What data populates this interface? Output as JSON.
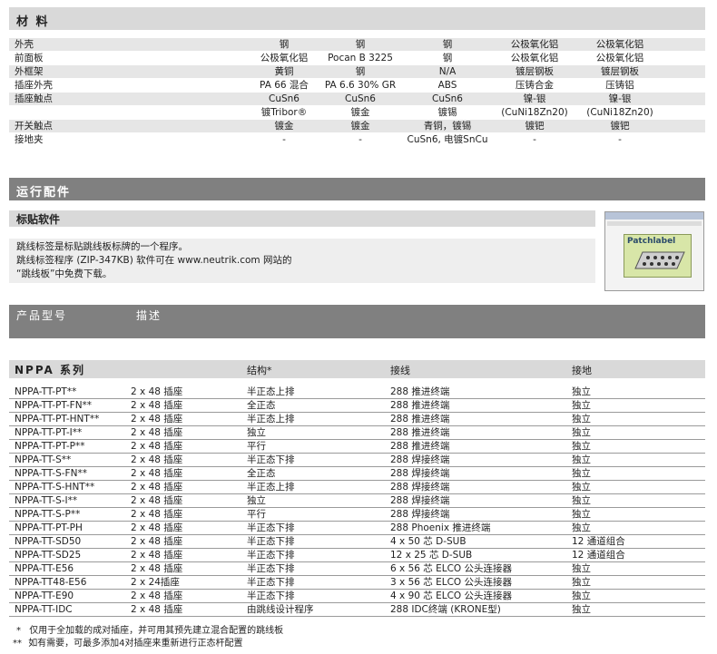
{
  "materials": {
    "title": "材 料",
    "rows": [
      {
        "label": "外壳",
        "values": [
          "钢",
          "钢",
          "钢",
          "公极氧化铝",
          "公极氧化铝"
        ]
      },
      {
        "label": "前面板",
        "values": [
          "公极氧化铝",
          "Pocan B 3225",
          "钢",
          "公极氧化铝",
          "公极氧化铝"
        ]
      },
      {
        "label": "外框架",
        "values": [
          "黄铜",
          "钢",
          "N/A",
          "镀层钢板",
          "镀层钢板"
        ]
      },
      {
        "label": "插座外壳",
        "values": [
          "PA 66 混合",
          "PA 6.6 30% GR",
          "ABS",
          "压铸合金",
          "压铸铝"
        ]
      },
      {
        "label": "插座触点",
        "values": [
          "CuSn6",
          "CuSn6",
          "CuSn6",
          "镍-银",
          "镍-银"
        ]
      },
      {
        "label": "",
        "values": [
          "镀Tribor®",
          "镀金",
          "镀锡",
          "(CuNi18Zn20)",
          "(CuNi18Zn20)"
        ]
      },
      {
        "label": "开关触点",
        "values": [
          "镀金",
          "镀金",
          "青铜，镀锡",
          "镀钯",
          "镀钯"
        ]
      },
      {
        "label": "接地夹",
        "values": [
          "-",
          "-",
          "CuSn6, 电镀SnCu",
          "-",
          "-"
        ]
      }
    ]
  },
  "accessories": {
    "title": "运行配件",
    "subtitle": "标贴软件",
    "lines": [
      "跳线标签是标贴跳线板标牌的一个程序。",
      "跳线标签程序 (ZIP-347KB) 软件可在 www.neutrik.com 网站的",
      "“跳线板”中免费下载。"
    ],
    "screenshot_label": "Patchlabel"
  },
  "product_header": {
    "col1": "产品型号",
    "col2": "描述"
  },
  "series": {
    "title": "NPPA 系列",
    "columns": [
      "结构*",
      "接线",
      "接地"
    ],
    "rows": [
      {
        "model": "NPPA-TT-PT**",
        "size": "2 x 48 插座",
        "structure": "半正态上排",
        "wiring": "288 推进终端",
        "ground": "独立"
      },
      {
        "model": "NPPA-TT-PT-FN**",
        "size": "2 x 48 插座",
        "structure": "全正态",
        "wiring": "288 推进终端",
        "ground": "独立"
      },
      {
        "model": "NPPA-TT-PT-HNT**",
        "size": "2 x 48 插座",
        "structure": "半正态上排",
        "wiring": "288 推进终端",
        "ground": "独立"
      },
      {
        "model": "NPPA-TT-PT-I**",
        "size": "2 x 48 插座",
        "structure": "独立",
        "wiring": "288 推进终端",
        "ground": "独立"
      },
      {
        "model": "NPPA-TT-PT-P**",
        "size": "2 x 48 插座",
        "structure": "平行",
        "wiring": "288 推进终端",
        "ground": "独立"
      },
      {
        "model": "NPPA-TT-S**",
        "size": "2 x 48 插座",
        "structure": "半正态下排",
        "wiring": "288 焊接终端",
        "ground": "独立"
      },
      {
        "model": "NPPA-TT-S-FN**",
        "size": "2 x 48 插座",
        "structure": "全正态",
        "wiring": "288 焊接终端",
        "ground": "独立"
      },
      {
        "model": "NPPA-TT-S-HNT**",
        "size": "2 x 48 插座",
        "structure": "半正态上排",
        "wiring": "288 焊接终端",
        "ground": "独立"
      },
      {
        "model": "NPPA-TT-S-I**",
        "size": "2 x 48 插座",
        "structure": "独立",
        "wiring": "288 焊接终端",
        "ground": "独立"
      },
      {
        "model": "NPPA-TT-S-P**",
        "size": "2 x 48 插座",
        "structure": "平行",
        "wiring": "288 焊接终端",
        "ground": "独立"
      },
      {
        "model": "NPPA-TT-PT-PH",
        "size": "2 x 48 插座",
        "structure": "半正态下排",
        "wiring": "288 Phoenix 推进终端",
        "ground": "独立"
      },
      {
        "model": "NPPA-TT-SD50",
        "size": "2 x 48 插座",
        "structure": "半正态下排",
        "wiring": "4 x 50 芯 D-SUB",
        "ground": "12 通道组合"
      },
      {
        "model": "NPPA-TT-SD25",
        "size": "2 x 48 插座",
        "structure": "半正态下排",
        "wiring": "12 x 25 芯 D-SUB",
        "ground": "12 通道组合"
      },
      {
        "model": "NPPA-TT-E56",
        "size": "2 x 48 插座",
        "structure": "半正态下排",
        "wiring": "6 x 56 芯 ELCO 公头连接器",
        "ground": "独立"
      },
      {
        "model": "NPPA-TT48-E56",
        "size": "2 x 24插座",
        "structure": "半正态下排",
        "wiring": "3 x 56 芯 ELCO 公头连接器",
        "ground": "独立"
      },
      {
        "model": "NPPA-TT-E90",
        "size": "2 x 48 插座",
        "structure": "半正态下排",
        "wiring": "4 x 90 芯 ELCO 公头连接器",
        "ground": "独立"
      },
      {
        "model": "NPPA-TT-IDC",
        "size": "2 x 48 插座",
        "structure": "由跳线设计程序",
        "wiring": "288 IDC终端 (KRONE型)",
        "ground": "独立"
      }
    ],
    "notes": [
      {
        "mark": "*",
        "text": "仅用于全加载的成对插座，并可用其预先建立混合配置的跳线板"
      },
      {
        "mark": "**",
        "text": "如有需要，可最多添加4对插座来重新进行正态杆配置"
      }
    ]
  }
}
